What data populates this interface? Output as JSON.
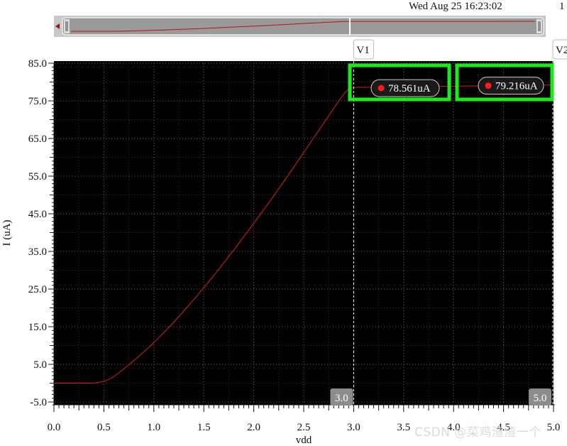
{
  "header": {
    "datetime": "Wed Aug 25 16:23:02",
    "page": "1"
  },
  "watermark": "CSDN @菜鸡渣渣一个",
  "colors": {
    "plot_bg": "#000000",
    "trace": "#e01818",
    "grid": "#6a6a6a",
    "highlight_box": "#1bea1b",
    "marker": "#ff1a1a"
  },
  "cursors": [
    {
      "name": "V1",
      "x": 3.0,
      "x_label": "3.0",
      "value_label": "78.561uA",
      "y": 78.561
    },
    {
      "name": "V2",
      "x": 5.0,
      "x_label": "5.0",
      "value_label": "79.216uA",
      "y": 79.216
    }
  ],
  "chart_data": {
    "type": "line",
    "xlabel": "vdd",
    "ylabel": "I (uA)",
    "xlim": [
      0.0,
      5.0
    ],
    "ylim": [
      -5.0,
      85.0
    ],
    "grid": true,
    "xticks": [
      "0.0",
      "0.5",
      "1.0",
      "1.5",
      "2.0",
      "2.5",
      "3.0",
      "3.5",
      "4.0",
      "4.5",
      "5.0"
    ],
    "yticks": [
      "85.0",
      "75.0",
      "65.0",
      "55.0",
      "45.0",
      "35.0",
      "25.0",
      "15.0",
      "5.0",
      "-5.0"
    ],
    "series": [
      {
        "x": [
          0.0,
          0.4,
          0.45,
          0.5,
          0.55,
          0.6,
          0.7,
          0.8,
          0.9,
          1.0,
          1.2,
          1.4,
          1.6,
          1.8,
          2.0,
          2.2,
          2.4,
          2.6,
          2.8,
          2.9,
          2.95,
          3.0,
          3.5,
          4.0,
          4.5,
          5.0
        ],
        "y": [
          0.0,
          0.0,
          0.2,
          0.5,
          1.0,
          1.8,
          3.8,
          6.0,
          8.3,
          10.8,
          16.2,
          22.2,
          28.6,
          35.4,
          42.5,
          49.8,
          57.4,
          65.2,
          73.0,
          76.8,
          78.2,
          78.561,
          78.72,
          78.88,
          79.05,
          79.216
        ]
      }
    ]
  }
}
